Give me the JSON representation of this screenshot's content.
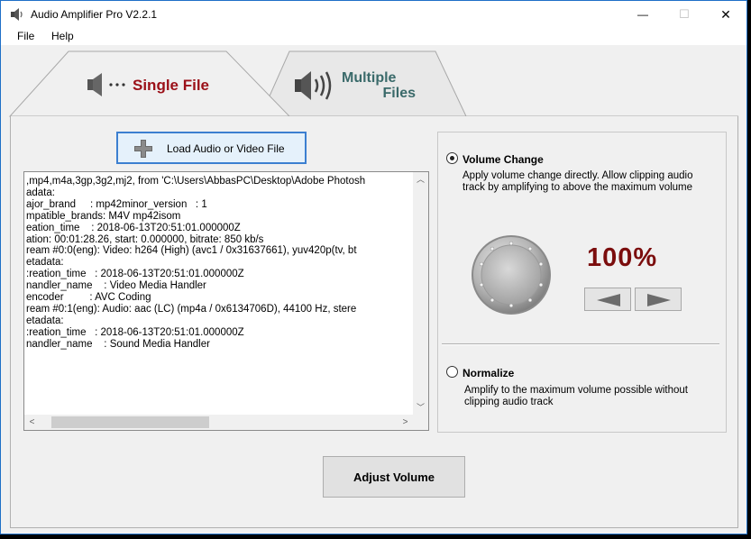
{
  "window": {
    "title": "Audio Amplifier Pro V2.2.1",
    "minimize_glyph": "—",
    "maximize_glyph": "☐",
    "close_glyph": "✕"
  },
  "menu": {
    "file": "File",
    "help": "Help"
  },
  "tabs": {
    "single": {
      "label": "Single File",
      "icon": "speaker-low-icon"
    },
    "multiple": {
      "label_line1": "Multiple",
      "label_line2": "Files",
      "icon": "speaker-loud-icon"
    }
  },
  "load_button": {
    "label": "Load Audio or Video File",
    "icon": "plus-icon"
  },
  "log_lines": [
    ",mp4,m4a,3gp,3g2,mj2, from 'C:\\Users\\AbbasPC\\Desktop\\Adobe Photosh",
    "adata:",
    "ajor_brand     : mp42minor_version   : 1",
    "mpatible_brands: M4V mp42isom",
    "eation_time    : 2018-06-13T20:51:01.000000Z",
    "ation: 00:01:28.26, start: 0.000000, bitrate: 850 kb/s",
    "ream #0:0(eng): Video: h264 (High) (avc1 / 0x31637661), yuv420p(tv, bt",
    "etadata:",
    ":reation_time   : 2018-06-13T20:51:01.000000Z",
    "nandler_name    : Video Media Handler",
    "encoder         : AVC Coding",
    "ream #0:1(eng): Audio: aac (LC) (mp4a / 0x6134706D), 44100 Hz, stere",
    "etadata:",
    ":reation_time   : 2018-06-13T20:51:01.000000Z",
    "nandler_name    : Sound Media Handler"
  ],
  "volume_change": {
    "title": "Volume Change",
    "description": "Apply volume change directly. Allow clipping audio track by amplifying to above the maximum volume",
    "selected": true,
    "percent_text": "100%",
    "percent_value": 100
  },
  "normalize": {
    "title": "Normalize",
    "description": "Amplify to the maximum volume possible without clipping audio track",
    "selected": false
  },
  "adjust_button": {
    "label": "Adjust Volume"
  },
  "colors": {
    "accent_red": "#9b1018",
    "percent_red": "#7b0d0d",
    "multi_teal": "#3a6a6a",
    "focus_blue": "#3c7fd0"
  }
}
